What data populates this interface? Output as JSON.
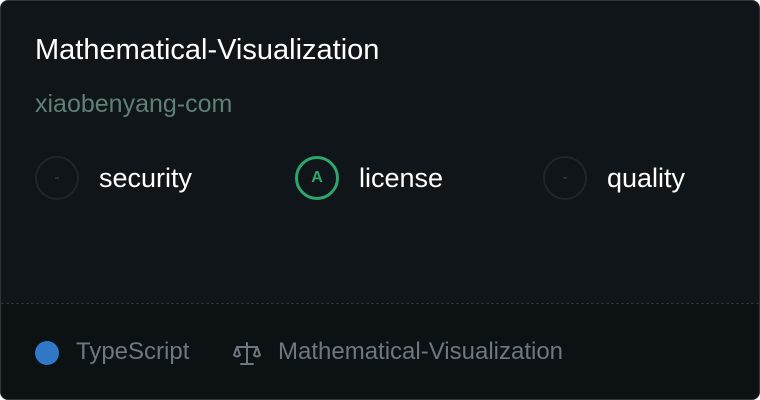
{
  "repo": {
    "name": "Mathematical-Visualization",
    "owner": "xiaobenyang-com"
  },
  "scores": [
    {
      "grade": "-",
      "label": "security",
      "state": "none"
    },
    {
      "grade": "A",
      "label": "license",
      "state": "graded",
      "color": "#2fa56c"
    },
    {
      "grade": "-",
      "label": "quality",
      "state": "none"
    }
  ],
  "footer": {
    "language": "TypeScript",
    "language_color": "#3178c6",
    "license_icon": "scale-icon",
    "license_text": "Mathematical-Visualization"
  }
}
